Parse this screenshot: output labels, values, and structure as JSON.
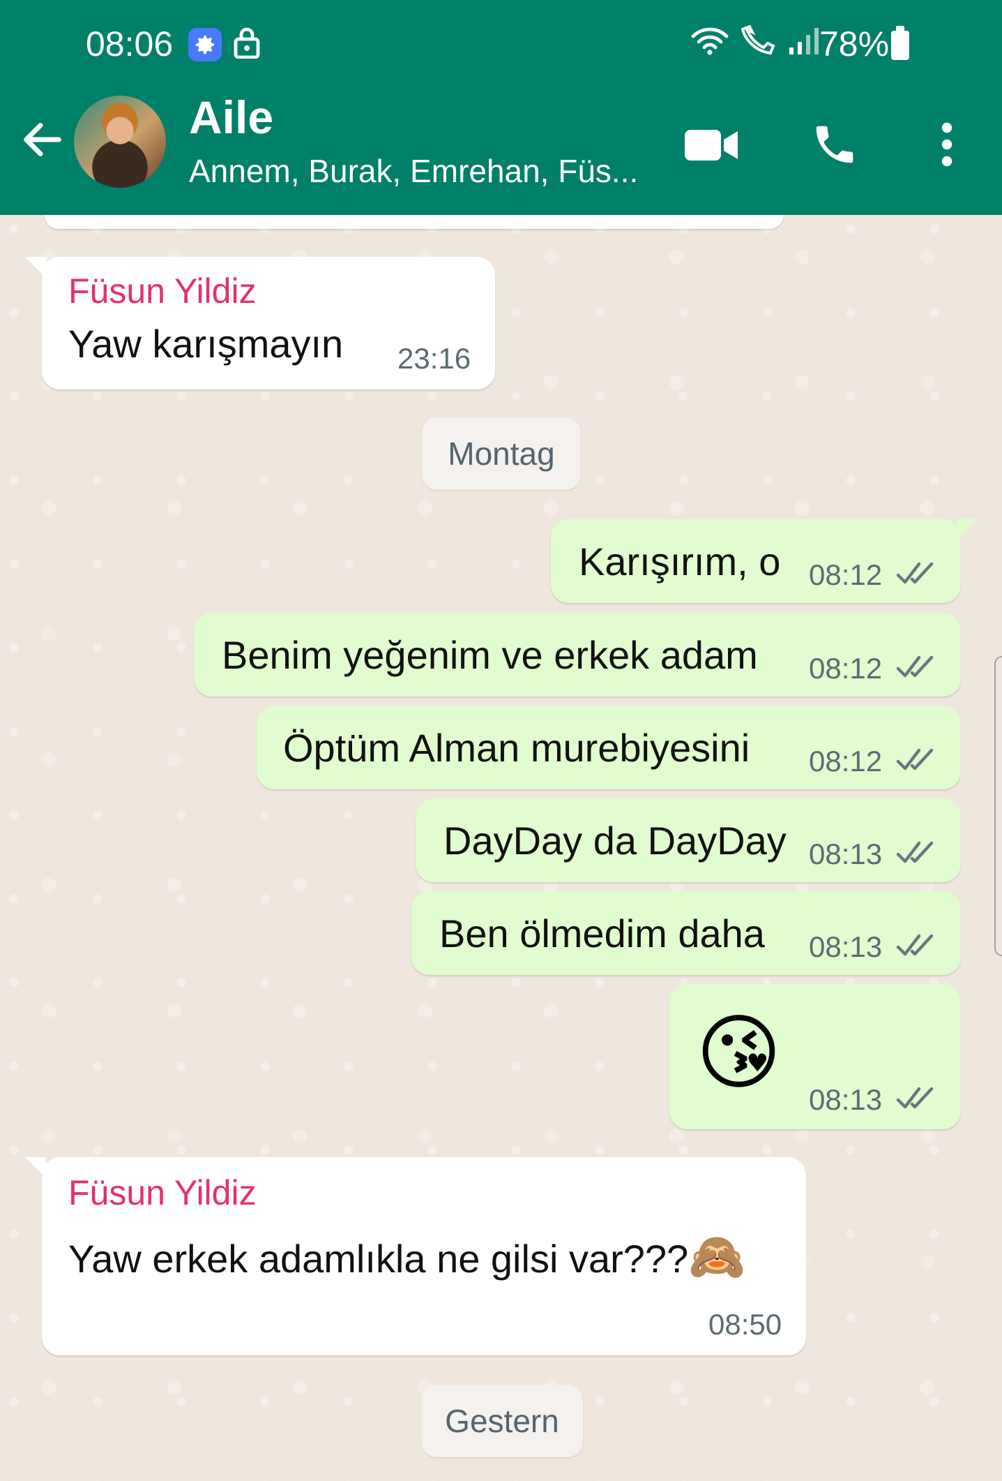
{
  "status_bar": {
    "time": "08:06",
    "battery": "78%",
    "icons": [
      "settings-icon",
      "lock-icon",
      "wifi-icon",
      "wifi-call-icon",
      "signal-icon",
      "battery-icon"
    ]
  },
  "header": {
    "title": "Aile",
    "subtitle": "Annem, Burak, Emrehan, Füs...",
    "background_color": "#008069"
  },
  "messages": [
    {
      "direction": "in",
      "sender": "Füsun Yildiz",
      "text": "Yaw karışmayın",
      "time": "23:16"
    },
    {
      "type": "date",
      "text": "Montag"
    },
    {
      "direction": "out",
      "text": "Karışırım, o",
      "time": "08:12",
      "status": "read"
    },
    {
      "direction": "out",
      "text": "Benim yeğenim ve erkek adam",
      "time": "08:12",
      "status": "read"
    },
    {
      "direction": "out",
      "text": "Öptüm Alman murebiyesini",
      "time": "08:12",
      "status": "read"
    },
    {
      "direction": "out",
      "text": "DayDay da DayDay",
      "time": "08:13",
      "status": "read"
    },
    {
      "direction": "out",
      "text": "Ben ölmedim daha",
      "time": "08:13",
      "status": "read"
    },
    {
      "direction": "out",
      "text": "😘",
      "time": "08:13",
      "status": "read"
    },
    {
      "direction": "in",
      "sender": "Füsun Yildiz",
      "text": "Yaw erkek adamlıkla ne gilsi var???",
      "emoji": "🙈",
      "time": "08:50"
    },
    {
      "type": "date",
      "text": "Gestern"
    }
  ],
  "colors": {
    "outgoing_bubble": "#e1fccf",
    "incoming_bubble": "#ffffff",
    "sender_name": "#e5306e",
    "chat_background": "#efe7de"
  }
}
